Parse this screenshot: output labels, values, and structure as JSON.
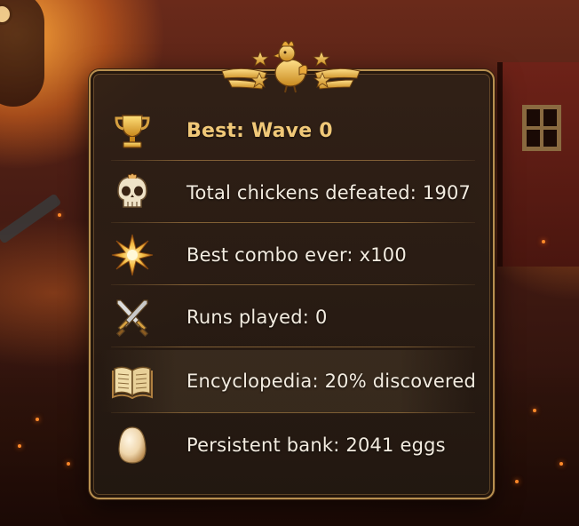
{
  "stats": [
    {
      "icon": "trophy-icon",
      "label": "Best: Wave 0"
    },
    {
      "icon": "skull-icon",
      "label": "Total chickens defeated: 1907"
    },
    {
      "icon": "burst-icon",
      "label": "Best combo ever: x100"
    },
    {
      "icon": "crossed-swords-icon",
      "label": "Runs played: 0"
    },
    {
      "icon": "open-book-icon",
      "label": "Encyclopedia: 20% discovered"
    },
    {
      "icon": "egg-icon",
      "label": "Persistent bank: 2041 eggs"
    }
  ],
  "emblem": {
    "icon": "chicken-crest-icon",
    "stars": 4
  },
  "colors": {
    "gold": "#f0c878",
    "text": "#f3ece0",
    "panel_border": "#b89050",
    "panel_bg": "#2e2016"
  }
}
